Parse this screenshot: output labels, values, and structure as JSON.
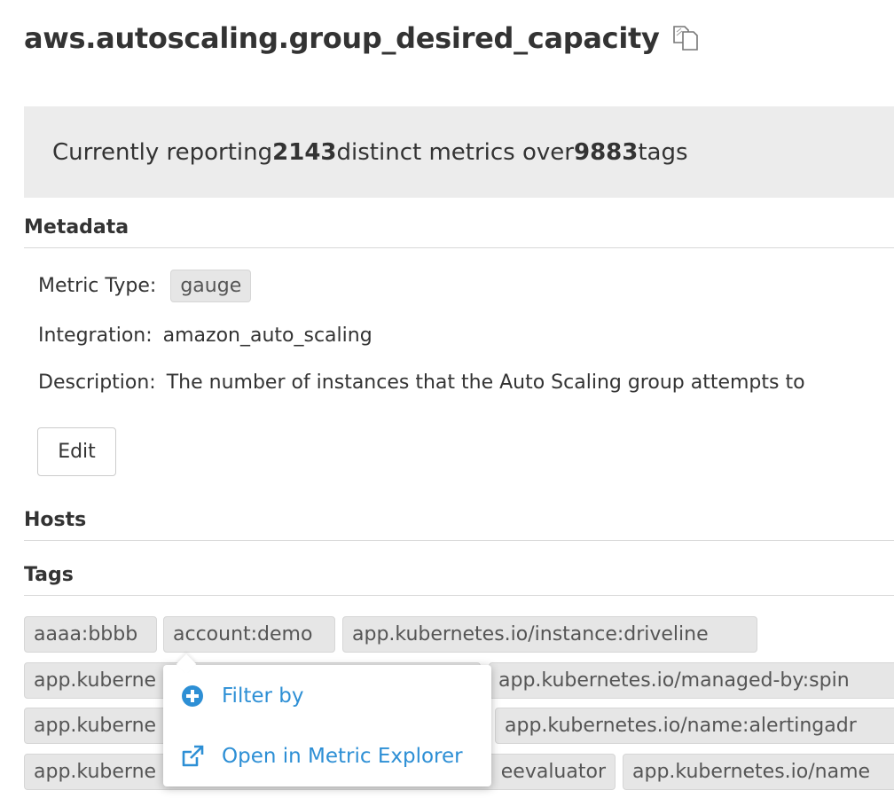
{
  "header": {
    "title": "aws.autoscaling.group_desired_capacity",
    "copy_icon": "copy-icon"
  },
  "banner": {
    "prefix": "Currently reporting ",
    "metrics_count": "2143",
    "middle": " distinct metrics over ",
    "tags_count": "9883",
    "suffix": " tags"
  },
  "metadata": {
    "heading": "Metadata",
    "metric_type_label": "Metric Type:",
    "metric_type_value": "gauge",
    "integration_label": "Integration:",
    "integration_value": "amazon_auto_scaling",
    "description_label": "Description:",
    "description_value": "The number of instances that the Auto Scaling group attempts to",
    "edit_label": "Edit"
  },
  "hosts": {
    "heading": "Hosts"
  },
  "tags": {
    "heading": "Tags",
    "items": [
      "aaaa:bbbb",
      "account:demo",
      "app.kubernetes.io/instance:driveline",
      "app.kuberne",
      "app.kubernetes.io/managed-by:spin",
      "app.kuberne",
      "app.kubernetes.io/name:alertingadr",
      "app.kuberne",
      "eevaluator",
      "app.kubernetes.io/name"
    ]
  },
  "popover": {
    "filter_label": "Filter by",
    "filter_icon": "plus-circle-icon",
    "explorer_label": "Open in Metric Explorer",
    "explorer_icon": "external-link-icon"
  },
  "colors": {
    "accent": "#2d8fd5",
    "banner_bg": "#ececec",
    "tag_bg": "#e6e6e6"
  }
}
